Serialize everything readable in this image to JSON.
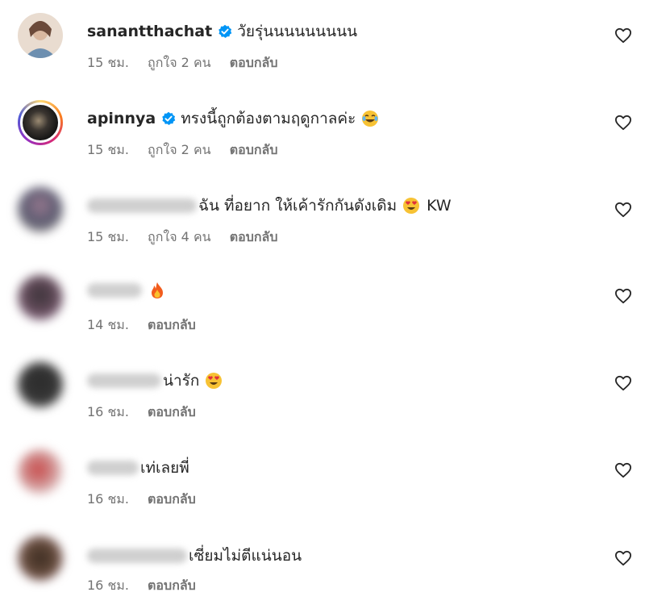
{
  "comments": [
    {
      "username": "sanantthachat",
      "text": "วัยรุ่นนนนนนนนน",
      "time": "15 ชม.",
      "likes": "ถูกใจ 2 คน",
      "reply": "ตอบกลับ"
    },
    {
      "username": "apinnya",
      "text": "ทรงนี้ถูกต้องตามฤดูกาลค่ะ",
      "time": "15 ชม.",
      "likes": "ถูกใจ 2 คน",
      "reply": "ตอบกลับ"
    },
    {
      "text": "ฉัน ที่อยาก ให้เค้ารักกันดังเดิม",
      "text_suffix": "KW",
      "time": "15 ชม.",
      "likes": "ถูกใจ 4 คน",
      "reply": "ตอบกลับ"
    },
    {
      "text": "",
      "time": "14 ชม.",
      "reply": "ตอบกลับ"
    },
    {
      "text": "น่ารัก",
      "time": "16 ชม.",
      "reply": "ตอบกลับ"
    },
    {
      "text": "เท่เลยพี่",
      "time": "16 ชม.",
      "reply": "ตอบกลับ"
    },
    {
      "text": "เซี่ยมไม่ตีแน่นอน",
      "time": "16 ชม.",
      "reply": "ตอบกลับ"
    }
  ],
  "icons": {
    "verified": "verified-badge-icon",
    "like": "heart-outline-icon"
  },
  "colors": {
    "verified": "#0095f6",
    "meta": "#737373"
  }
}
